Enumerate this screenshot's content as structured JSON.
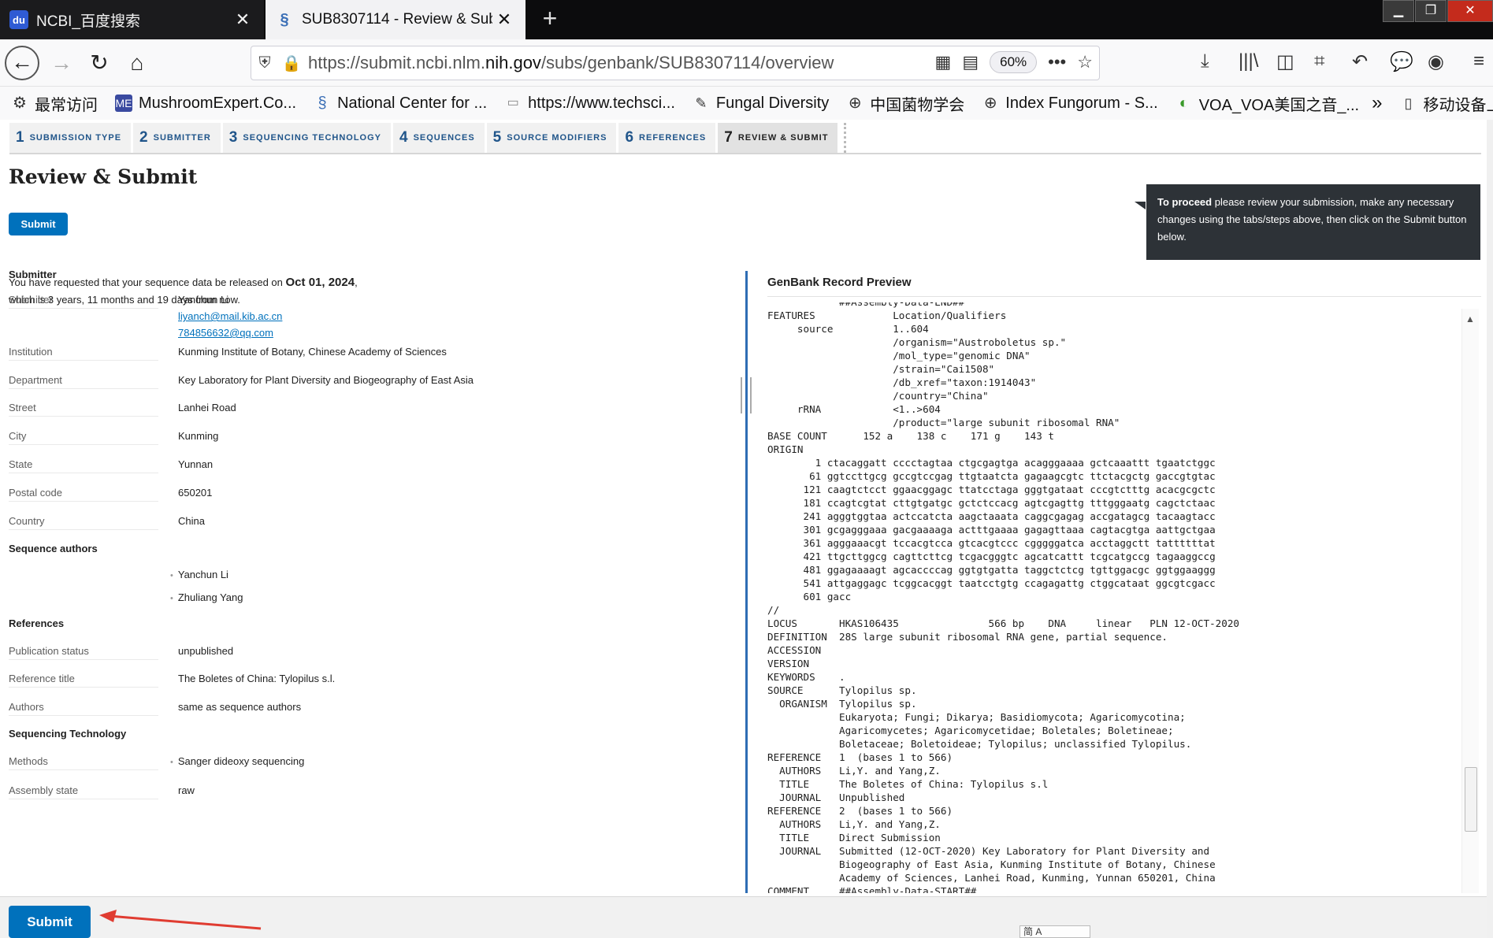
{
  "browser": {
    "tabs": [
      {
        "title": "NCBI_百度搜索",
        "favicon": "baidu-paw-icon",
        "active": false
      },
      {
        "title": "SUB8307114 - Review & Sub",
        "favicon": "ncbi-helix-icon",
        "active": true
      }
    ],
    "url_prefix": "https://submit.ncbi.nlm.",
    "url_domain": "nih.gov",
    "url_path": "/subs/genbank/SUB8307114/overview",
    "zoom": "60%",
    "bookmarks": [
      {
        "label": "最常访问",
        "icon": "gear-icon"
      },
      {
        "label": "MushroomExpert.Co...",
        "icon": "me-icon"
      },
      {
        "label": "National Center for ...",
        "icon": "ncbi-helix-icon"
      },
      {
        "label": "https://www.techsci...",
        "icon": "page-icon"
      },
      {
        "label": "Fungal Diversity",
        "icon": "book-icon"
      },
      {
        "label": "中国菌物学会",
        "icon": "globe-icon"
      },
      {
        "label": "Index Fungorum - S...",
        "icon": "globe-icon"
      },
      {
        "label": "VOA_VOA美国之音_...",
        "icon": "voa-icon"
      },
      {
        "label": "移动设备上的书签",
        "icon": "mobile-icon"
      }
    ]
  },
  "steps": [
    {
      "num": "1",
      "label": "Submission type"
    },
    {
      "num": "2",
      "label": "Submitter"
    },
    {
      "num": "3",
      "label": "Sequencing technology"
    },
    {
      "num": "4",
      "label": "Sequences"
    },
    {
      "num": "5",
      "label": "Source modifiers"
    },
    {
      "num": "6",
      "label": "References"
    },
    {
      "num": "7",
      "label": "Review & submit"
    }
  ],
  "page": {
    "title": "Review & Submit",
    "submit_label": "Submit",
    "callout_bold": "To proceed",
    "callout_text": " please review your submission, make any necessary changes using the tabs/steps above, then click on the Submit button below.",
    "release_prefix": "You have requested that your sequence data be released on ",
    "release_date": "Oct 01, 2024",
    "release_comma": ",",
    "release_line2": "which is 3 years, 11 months and 19 days from now."
  },
  "submitter": {
    "section": "Submitter",
    "submitter_label": "Submitter",
    "name": "Yanchun Li",
    "email1": "liyanch@mail.kib.ac.cn",
    "email2": "784856632@qq.com",
    "institution_label": "Institution",
    "institution": "Kunming Institute of Botany, Chinese Academy of Sciences",
    "department_label": "Department",
    "department": "Key Laboratory for Plant Diversity and Biogeography of East Asia",
    "street_label": "Street",
    "street": "Lanhei Road",
    "city_label": "City",
    "city": "Kunming",
    "state_label": "State",
    "state": "Yunnan",
    "postal_label": "Postal code",
    "postal": "650201",
    "country_label": "Country",
    "country": "China"
  },
  "authors": {
    "section": "Sequence authors",
    "list": [
      "Yanchun Li",
      "Zhuliang Yang"
    ]
  },
  "references": {
    "section": "References",
    "status_label": "Publication status",
    "status": "unpublished",
    "title_label": "Reference title",
    "title": "The Boletes of China: Tylopilus s.l.",
    "authors_label": "Authors",
    "authors": "same as sequence authors"
  },
  "seqtech": {
    "section": "Sequencing Technology",
    "methods_label": "Methods",
    "methods": "Sanger dideoxy sequencing",
    "assembly_label": "Assembly state",
    "assembly": "raw"
  },
  "genbank": {
    "title": "GenBank Record Preview",
    "lines": [
      "            ##Assembly-Data-END##",
      "FEATURES             Location/Qualifiers",
      "     source          1..604",
      "                     /organism=\"Austroboletus sp.\"",
      "                     /mol_type=\"genomic DNA\"",
      "                     /strain=\"Cai1508\"",
      "                     /db_xref=\"taxon:1914043\"",
      "                     /country=\"China\"",
      "     rRNA            <1..>604",
      "                     /product=\"large subunit ribosomal RNA\"",
      "BASE COUNT      152 a    138 c    171 g    143 t",
      "ORIGIN",
      "        1 ctacaggatt cccctagtaa ctgcgagtga acagggaaaa gctcaaattt tgaatctggc",
      "       61 ggtccttgcg gccgtccgag ttgtaatcta gagaagcgtc ttctacgctg gaccgtgtac",
      "      121 caagtctcct ggaacggagc ttatcctaga gggtgataat cccgtctttg acacgcgctc",
      "      181 ccagtcgtat cttgtgatgc gctctccacg agtcgagttg tttgggaatg cagctctaac",
      "      241 agggtggtaa actccatcta aagctaaata caggcgagag accgatagcg tacaagtacc",
      "      301 gcgagggaaa gacgaaaaga actttgaaaa gagagttaaa cagtacgtga aattgctgaa",
      "      361 agggaaacgt tccacgtcca gtcacgtccc cgggggatca acctaggctt tattttttat",
      "      421 ttgcttggcg cagttcttcg tcgacgggtc agcatcattt tcgcatgccg tagaaggccg",
      "      481 ggagaaaagt agcaccccag ggtgtgatta taggctctcg tgttggacgc ggtggaaggg",
      "      541 attgaggagc tcggcacggt taatcctgtg ccagagattg ctggcataat ggcgtcgacc",
      "      601 gacc",
      "//",
      "LOCUS       HKAS106435               566 bp    DNA     linear   PLN 12-OCT-2020",
      "DEFINITION  28S large subunit ribosomal RNA gene, partial sequence.",
      "ACCESSION",
      "VERSION",
      "KEYWORDS    .",
      "SOURCE      Tylopilus sp.",
      "  ORGANISM  Tylopilus sp.",
      "            Eukaryota; Fungi; Dikarya; Basidiomycota; Agaricomycotina;",
      "            Agaricomycetes; Agaricomycetidae; Boletales; Boletineae;",
      "            Boletaceae; Boletoideae; Tylopilus; unclassified Tylopilus.",
      "REFERENCE   1  (bases 1 to 566)",
      "  AUTHORS   Li,Y. and Yang,Z.",
      "  TITLE     The Boletes of China: Tylopilus s.l",
      "  JOURNAL   Unpublished",
      "REFERENCE   2  (bases 1 to 566)",
      "  AUTHORS   Li,Y. and Yang,Z.",
      "  TITLE     Direct Submission",
      "  JOURNAL   Submitted (12-OCT-2020) Key Laboratory for Plant Diversity and",
      "            Biogeography of East Asia, Kunming Institute of Botany, Chinese",
      "            Academy of Sciences, Lanhei Road, Kunming, Yunnan 650201, China",
      "COMMENT     ##Assembly-Data-START##"
    ]
  },
  "ime_text": "简 A",
  "colors": {
    "primary": "#0071bc",
    "callout": "#2d3237",
    "divider": "#2e6db4",
    "arrow": "#e03c31"
  }
}
